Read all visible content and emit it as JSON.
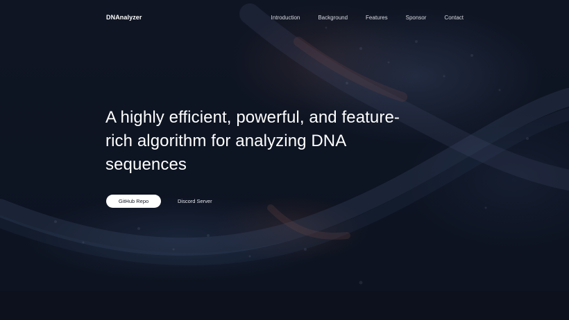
{
  "header": {
    "brand": "DNAnalyzer",
    "nav_items": [
      {
        "label": "Introduction"
      },
      {
        "label": "Background"
      },
      {
        "label": "Features"
      },
      {
        "label": "Sponsor"
      },
      {
        "label": "Contact"
      }
    ]
  },
  "hero": {
    "headline": "A highly efficient, powerful, and feature-rich algorithm for analyzing DNA sequences",
    "primary_button": "GitHub Repo",
    "secondary_button": "Discord Server",
    "background_image": "dna-helix-particles"
  },
  "colors": {
    "background": "#0d1220",
    "text": "#ffffff",
    "button_bg": "#ffffff",
    "button_text": "#111827"
  }
}
